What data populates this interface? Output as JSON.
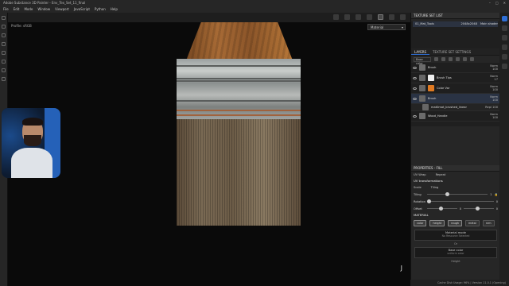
{
  "window": {
    "title": "Adobe Substance 3D Painter - Env_Tex_Set_11_final"
  },
  "menu": [
    "File",
    "Edit",
    "Mode",
    "Window",
    "Viewport",
    "JavaScript",
    "Python",
    "Help"
  ],
  "viewport": {
    "label": "Profile: sRGB",
    "mode_dropdown": "Material",
    "axis": "J"
  },
  "texture_set_list": {
    "header": "TEXTURE SET LIST",
    "items": [
      {
        "name": "01_Mat_Tools",
        "size": "2048x2048",
        "shader": "Main shader"
      }
    ]
  },
  "layers_panel": {
    "tabs": [
      "LAYERS",
      "TEXTURE SET SETTINGS"
    ],
    "channel": "Base color",
    "layers": [
      {
        "name": "Brush",
        "blend": "Norm",
        "opacity": "100",
        "kind": "folder"
      },
      {
        "name": "Brush Tips",
        "blend": "Norm",
        "opacity": "17",
        "kind": "fill"
      },
      {
        "name": "Color Var",
        "blend": "Norm",
        "opacity": "100",
        "kind": "color"
      },
      {
        "name": "Brush",
        "blend": "Norm",
        "opacity": "100",
        "kind": "fill"
      },
      {
        "name": "mat0mat_brushed_linear",
        "blend": "Repl",
        "opacity": "100",
        "kind": "sub"
      },
      {
        "name": "Wood_Handle",
        "blend": "Norm",
        "opacity": "100",
        "kind": "folder"
      }
    ]
  },
  "properties": {
    "header": "PROPERTIES - FILL",
    "uv_wrap_label": "UV Wrap",
    "uv_wrap_value": "Repeat",
    "uv_section": "UV transformations",
    "scale_label": "Scale",
    "scale_value": "Tiling",
    "tiling_label": "Tiling",
    "tiling_value": "1",
    "rotation_label": "Rotation",
    "rotation_value": "0",
    "offset_label": "Offset",
    "offset_values": [
      "0",
      "0"
    ],
    "material_header": "MATERIAL",
    "channels": [
      "color",
      "height",
      "rough",
      "metal",
      "nrm"
    ],
    "material_mode": "Material mode",
    "material_mode_sub": "No Resource Selected",
    "or_text": "Or",
    "base_color": "Base color",
    "base_color_sub": "uniform color",
    "height_label": "Height"
  },
  "status": {
    "text": "Cache Disk Usage: 96% | Version 11.0.1 (Opening)"
  },
  "colors": {
    "accent": "#2f6fd6",
    "viewport_bg": "#0a0a0a",
    "panel_bg": "#262626"
  }
}
